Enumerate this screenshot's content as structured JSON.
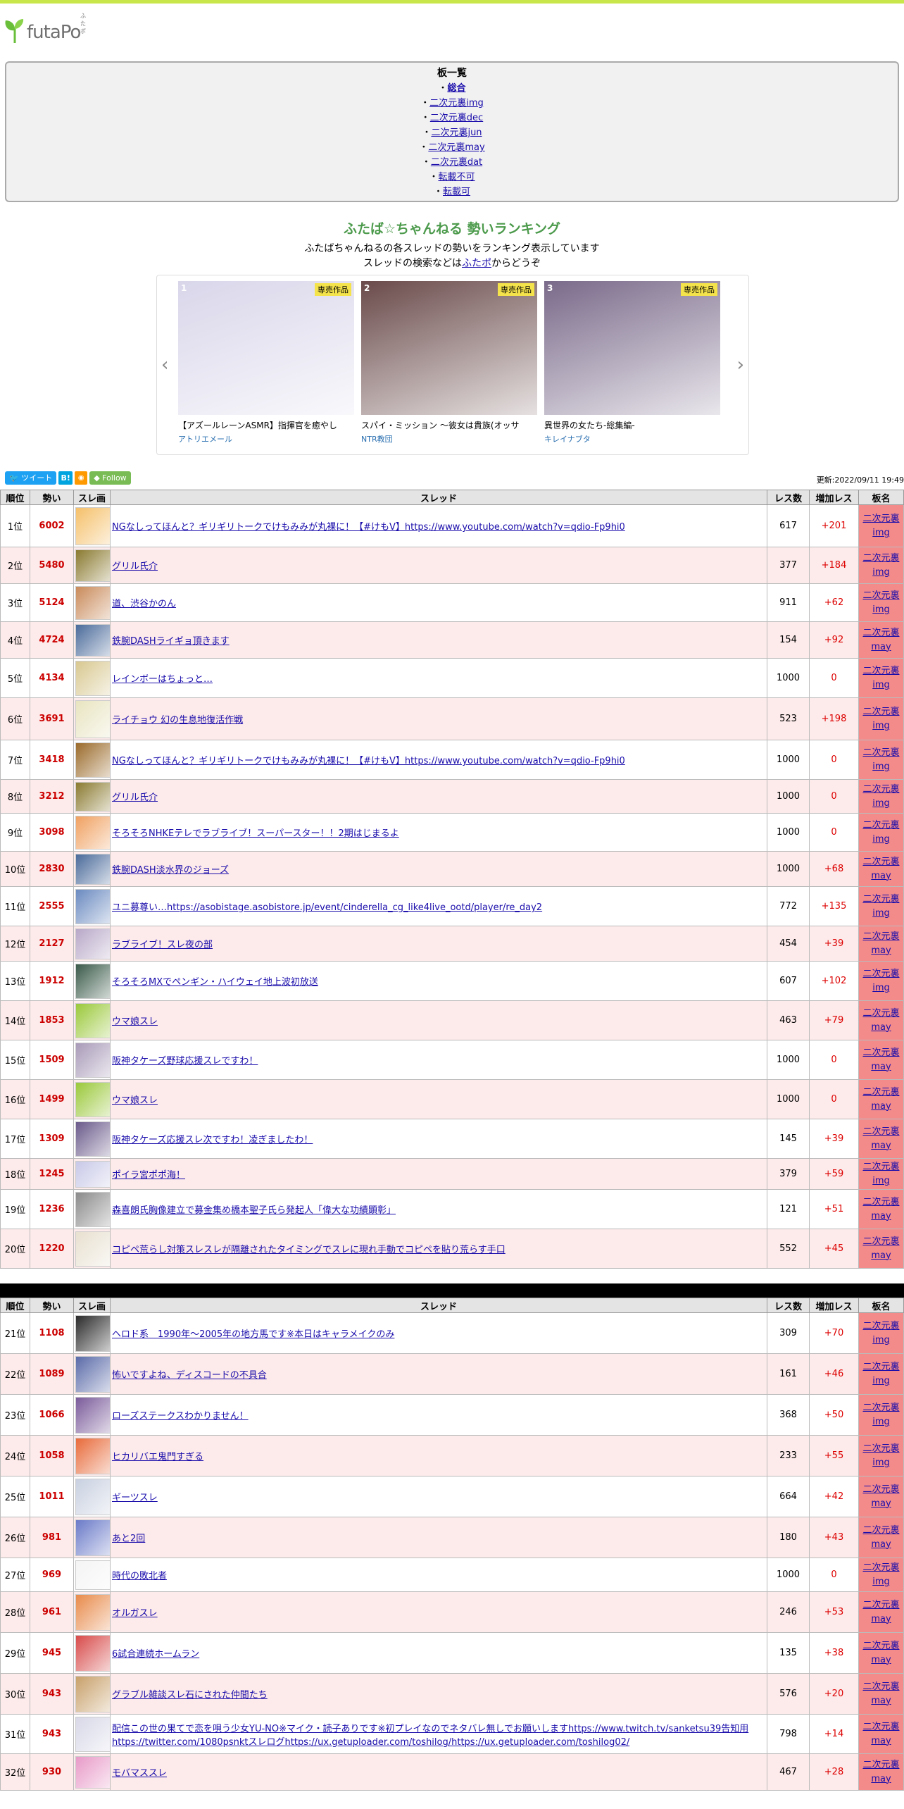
{
  "site": {
    "name": "futaPo",
    "ruby": "ふたポ"
  },
  "board_list": {
    "heading": "板一覧",
    "items": [
      {
        "label": "総合",
        "current": true
      },
      {
        "label": "二次元裏img"
      },
      {
        "label": "二次元裏dec"
      },
      {
        "label": "二次元裏jun"
      },
      {
        "label": "二次元裏may"
      },
      {
        "label": "二次元裏dat"
      },
      {
        "label": "転載不可"
      },
      {
        "label": "転載可"
      }
    ]
  },
  "ranking": {
    "title": "ふたば☆ちゃんねる 勢いランキング",
    "desc_line1": "ふたばちゃんねるの各スレッドの勢いをランキング表示しています",
    "desc_line2_pre": "スレッドの検索などは",
    "desc_line2_link": "ふたポ",
    "desc_line2_post": "からどうぞ"
  },
  "carousel": {
    "prev_icon": "‹",
    "next_icon": "›",
    "items": [
      {
        "num": "1",
        "badge": "専売作品",
        "title": "【アズールレーンASMR】指揮官を癒やし",
        "circle": "アトリエメール",
        "color": "#d9d6ea"
      },
      {
        "num": "2",
        "badge": "専売作品",
        "title": "スパイ・ミッション ～彼女は貴族(オッサ",
        "circle": "NTR教団",
        "color": "#6a4a4a"
      },
      {
        "num": "3",
        "badge": "専売作品",
        "title": "異世界の女たち-総集編-",
        "circle": "キレイナブタ",
        "color": "#7a6a8a"
      }
    ]
  },
  "share": {
    "tweet": "ツイート",
    "hatena": "B!",
    "rss": "RSS",
    "follow": "Follow"
  },
  "updated": "更新:2022/09/11 19:49",
  "table": {
    "headers": [
      "順位",
      "勢い",
      "スレ画",
      "スレッド",
      "レス数",
      "増加レス",
      "板名"
    ],
    "rows": [
      {
        "rank": "1位",
        "ikioi": "6002",
        "title": "NGなしってほんと？ギリギリトークでけもみみが丸裸に！【#けもV】https://www.youtube.com/watch?v=qdio-Fp9hi0",
        "res": "617",
        "inc": "+201",
        "board": "二次元裏img",
        "color": "#f5c06a"
      },
      {
        "rank": "2位",
        "ikioi": "5480",
        "title": "グリル氏介",
        "res": "377",
        "inc": "+184",
        "board": "二次元裏img",
        "color": "#8a7a30"
      },
      {
        "rank": "3位",
        "ikioi": "5124",
        "title": "道、渋谷かのん",
        "res": "911",
        "inc": "+62",
        "board": "二次元裏img",
        "color": "#c98a5a"
      },
      {
        "rank": "4位",
        "ikioi": "4724",
        "title": "鉄腕DASHライギョ頂きます",
        "res": "154",
        "inc": "+92",
        "board": "二次元裏may",
        "color": "#4a6a9a"
      },
      {
        "rank": "5位",
        "ikioi": "4134",
        "title": "レインボーはちょっと…",
        "res": "1000",
        "inc": "0",
        "board": "二次元裏img",
        "color": "#d8c890"
      },
      {
        "rank": "6位",
        "ikioi": "3691",
        "title": "ライチョウ 幻の生息地復活作戦",
        "res": "523",
        "inc": "+198",
        "board": "二次元裏img",
        "color": "#e8e4c0"
      },
      {
        "rank": "7位",
        "ikioi": "3418",
        "title": "NGなしってほんと？ギリギリトークでけもみみが丸裸に！【#けもV】https://www.youtube.com/watch?v=qdio-Fp9hi0",
        "res": "1000",
        "inc": "0",
        "board": "二次元裏img",
        "color": "#9a6a2a"
      },
      {
        "rank": "8位",
        "ikioi": "3212",
        "title": "グリル氏介",
        "res": "1000",
        "inc": "0",
        "board": "二次元裏img",
        "color": "#8a7a30"
      },
      {
        "rank": "9位",
        "ikioi": "3098",
        "title": "そろそろNHKEテレでラブライブ！スーパースター！！2期はじまるよ",
        "res": "1000",
        "inc": "0",
        "board": "二次元裏img",
        "color": "#f0a060"
      },
      {
        "rank": "10位",
        "ikioi": "2830",
        "title": "鉄腕DASH淡水界のジョーズ",
        "res": "1000",
        "inc": "+68",
        "board": "二次元裏may",
        "color": "#4a6a9a"
      },
      {
        "rank": "11位",
        "ikioi": "2555",
        "title": "ユニ募尊い…https://asobistage.asobistore.jp/event/cinderella_cg_like4live_ootd/player/re_day2",
        "res": "772",
        "inc": "+135",
        "board": "二次元裏img",
        "color": "#6a8ac0"
      },
      {
        "rank": "12位",
        "ikioi": "2127",
        "title": "ラブライブ！スレ夜の部",
        "res": "454",
        "inc": "+39",
        "board": "二次元裏may",
        "color": "#b8a8c8"
      },
      {
        "rank": "13位",
        "ikioi": "1912",
        "title": "そろそろMXでペンギン・ハイウェイ地上波初放送",
        "res": "607",
        "inc": "+102",
        "board": "二次元裏img",
        "color": "#3a5a4a"
      },
      {
        "rank": "14位",
        "ikioi": "1853",
        "title": "ウマ娘スレ",
        "res": "463",
        "inc": "+79",
        "board": "二次元裏may",
        "color": "#9ac83a"
      },
      {
        "rank": "15位",
        "ikioi": "1509",
        "title": "阪神タケーズ野球応援スレですわ！",
        "res": "1000",
        "inc": "0",
        "board": "二次元裏may",
        "color": "#a89ab8"
      },
      {
        "rank": "16位",
        "ikioi": "1499",
        "title": "ウマ娘スレ",
        "res": "1000",
        "inc": "0",
        "board": "二次元裏may",
        "color": "#9ac83a"
      },
      {
        "rank": "17位",
        "ikioi": "1309",
        "title": "阪神タケーズ応援スレ次ですわ！凌ぎましたわ！",
        "res": "145",
        "inc": "+39",
        "board": "二次元裏may",
        "color": "#6a5a8a"
      },
      {
        "rank": "18位",
        "ikioi": "1245",
        "title": "ポイラ宮ポポ海！",
        "res": "379",
        "inc": "+59",
        "board": "二次元裏img",
        "color": "#c8c8e8"
      },
      {
        "rank": "19位",
        "ikioi": "1236",
        "title": "森喜朗氏胸像建立で募金集め橋本聖子氏ら発起人「偉大な功績顕彰」",
        "res": "121",
        "inc": "+51",
        "board": "二次元裏may",
        "color": "#8a8a8a"
      },
      {
        "rank": "20位",
        "ikioi": "1220",
        "title": "コピペ荒らし対策スレスレが隔離されたタイミングでスレに現れ手動でコピペを貼り荒らす手口",
        "res": "552",
        "inc": "+45",
        "board": "二次元裏may",
        "color": "#e8e0d0"
      }
    ],
    "rows2": [
      {
        "rank": "21位",
        "ikioi": "1108",
        "title": "ヘロド系　1990年〜2005年の地方馬です※本日はキャラメイクのみ",
        "res": "309",
        "inc": "+70",
        "board": "二次元裏img",
        "color": "#2a2a2a"
      },
      {
        "rank": "22位",
        "ikioi": "1089",
        "title": "怖いですよね、ディスコードの不具合",
        "res": "161",
        "inc": "+46",
        "board": "二次元裏img",
        "color": "#5a6aa8"
      },
      {
        "rank": "23位",
        "ikioi": "1066",
        "title": "ローズステークスわかりません！",
        "res": "368",
        "inc": "+50",
        "board": "二次元裏img",
        "color": "#7a5a9a"
      },
      {
        "rank": "24位",
        "ikioi": "1058",
        "title": "ヒカリバエ鬼門すぎる",
        "res": "233",
        "inc": "+55",
        "board": "二次元裏img",
        "color": "#e86a3a"
      },
      {
        "rank": "25位",
        "ikioi": "1011",
        "title": "ギーツスレ",
        "res": "664",
        "inc": "+42",
        "board": "二次元裏may",
        "color": "#c8d0e0"
      },
      {
        "rank": "26位",
        "ikioi": "981",
        "title": "あと2回",
        "res": "180",
        "inc": "+43",
        "board": "二次元裏may",
        "color": "#6a7ac8"
      },
      {
        "rank": "27位",
        "ikioi": "969",
        "title": "時代の敗北者",
        "res": "1000",
        "inc": "0",
        "board": "二次元裏img",
        "color": "#f4f4f4"
      },
      {
        "rank": "28位",
        "ikioi": "961",
        "title": "オルガスレ",
        "res": "246",
        "inc": "+53",
        "board": "二次元裏may",
        "color": "#e88a4a"
      },
      {
        "rank": "29位",
        "ikioi": "945",
        "title": "6試合連続ホームラン",
        "res": "135",
        "inc": "+38",
        "board": "二次元裏may",
        "color": "#d84a4a"
      },
      {
        "rank": "30位",
        "ikioi": "943",
        "title": "グラブル雑談スレ石にされた仲間たち",
        "res": "576",
        "inc": "+20",
        "board": "二次元裏may",
        "color": "#c8a06a"
      },
      {
        "rank": "31位",
        "ikioi": "943",
        "title": "配信この世の果てで恋を唄う少女YU-NO※マイク・読子ありです※初プレイなのでネタバレ無しでお願いしますhttps://www.twitch.tv/sanketsu39告知用https://twitter.com/1080psnktスレログhttps://ux.getuploader.com/toshilog/https://ux.getuploader.com/toshilog02/",
        "res": "798",
        "inc": "+14",
        "board": "二次元裏may",
        "color": "#d8d8e8"
      },
      {
        "rank": "32位",
        "ikioi": "930",
        "title": "モバマススレ",
        "res": "467",
        "inc": "+28",
        "board": "二次元裏may",
        "color": "#e89ac8"
      }
    ]
  }
}
